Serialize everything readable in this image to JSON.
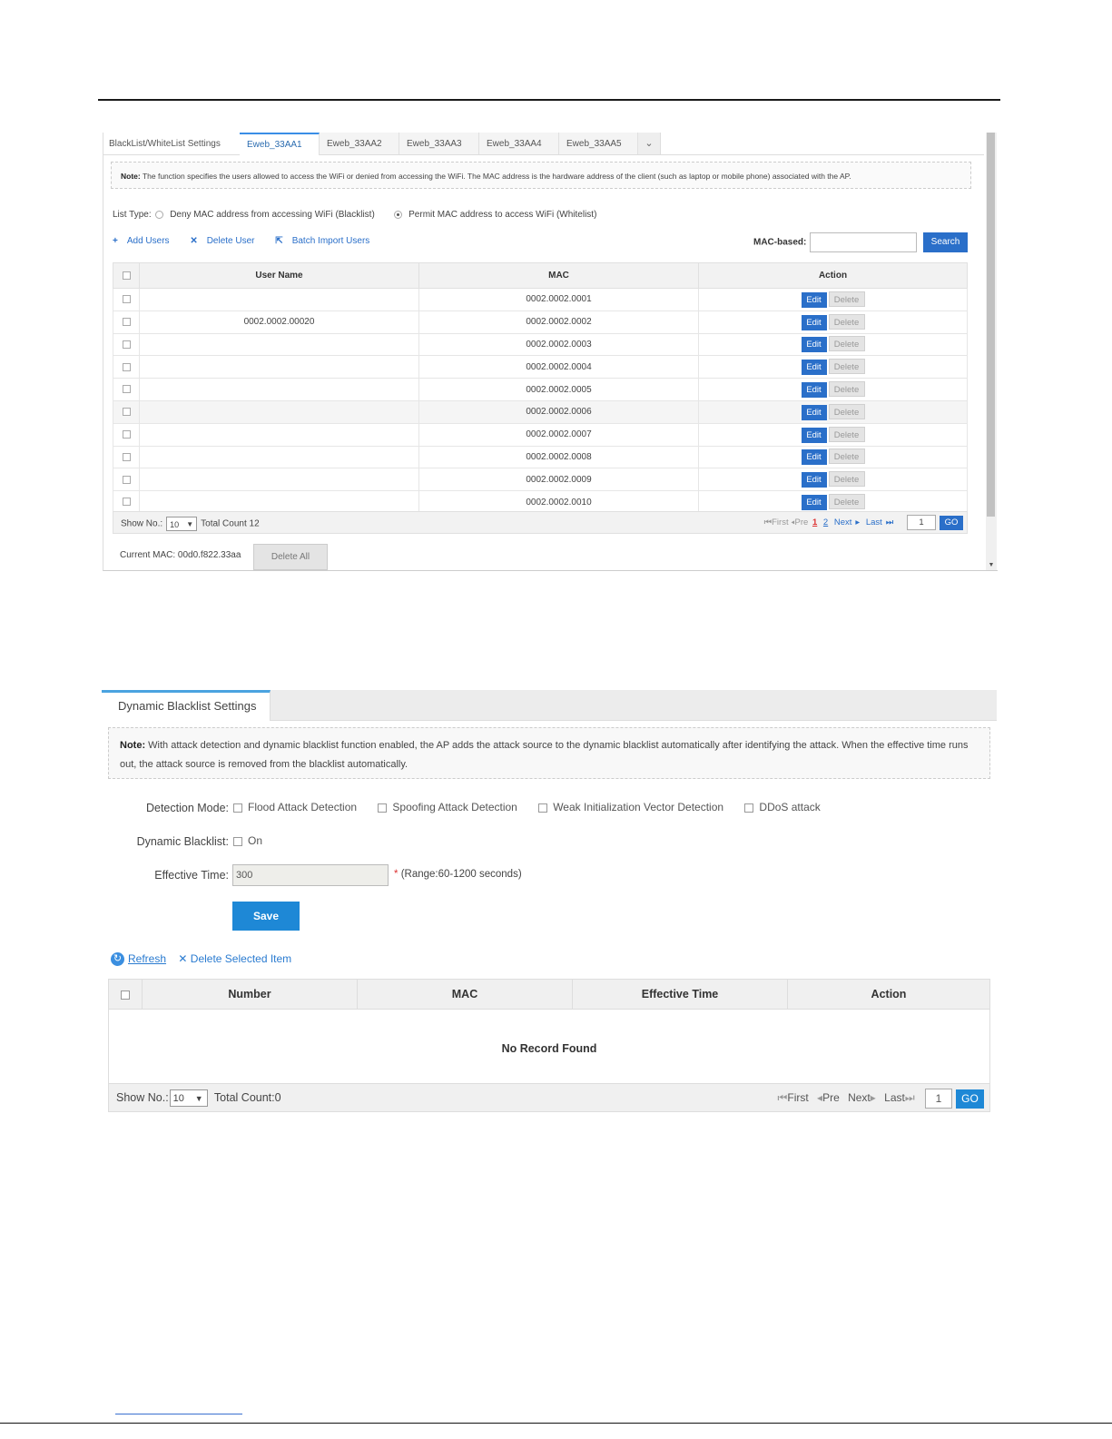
{
  "shot1": {
    "tabs": [
      "BlackList/WhiteList Settings",
      "Eweb_33AA1",
      "Eweb_33AA2",
      "Eweb_33AA3",
      "Eweb_33AA4",
      "Eweb_33AA5"
    ],
    "note_label": "Note:",
    "note_text": "The function specifies the users allowed to access the WiFi or denied from accessing the WiFi. The MAC address is the hardware address of the client (such as laptop or mobile phone) associated with the AP.",
    "list_type_label": "List Type:",
    "radio_blacklist": "Deny MAC address from accessing WiFi (Blacklist)",
    "radio_whitelist": "Permit MAC address to access WiFi (Whitelist)",
    "add_users": "Add Users",
    "delete_user": "Delete User",
    "batch_import": "Batch Import Users",
    "mac_based_label": "MAC-based:",
    "search_button": "Search",
    "columns": [
      "User Name",
      "MAC",
      "Action"
    ],
    "rows": [
      {
        "user": "",
        "mac": "0002.0002.0001"
      },
      {
        "user": "0002.0002.00020",
        "mac": "0002.0002.0002"
      },
      {
        "user": "",
        "mac": "0002.0002.0003"
      },
      {
        "user": "",
        "mac": "0002.0002.0004"
      },
      {
        "user": "",
        "mac": "0002.0002.0005"
      },
      {
        "user": "",
        "mac": "0002.0002.0006"
      },
      {
        "user": "",
        "mac": "0002.0002.0007"
      },
      {
        "user": "",
        "mac": "0002.0002.0008"
      },
      {
        "user": "",
        "mac": "0002.0002.0009"
      },
      {
        "user": "",
        "mac": "0002.0002.0010"
      }
    ],
    "edit_label": "Edit",
    "delete_label": "Delete",
    "show_no_label": "Show No.:",
    "show_no_value": "10",
    "total_count": "Total Count 12",
    "pager": {
      "first": "First",
      "pre": "Pre",
      "page1": "1",
      "page2": "2",
      "next": "Next",
      "last": "Last",
      "page_input": "1",
      "go": "GO"
    },
    "current_mac": "Current MAC: 00d0.f822.33aa",
    "delete_all": "Delete All"
  },
  "shot2": {
    "tab": "Dynamic Blacklist Settings",
    "note_label": "Note:",
    "note_text": "With attack detection and dynamic blacklist function enabled, the AP adds the attack source to the dynamic blacklist automatically after identifying the attack. When the effective time runs out, the attack source is removed from the blacklist automatically.",
    "detection_mode_label": "Detection Mode:",
    "detection_options": [
      "Flood Attack Detection",
      "Spoofing Attack Detection",
      "Weak Initialization Vector Detection",
      "DDoS attack"
    ],
    "dynamic_blacklist_label": "Dynamic Blacklist:",
    "dynamic_blacklist_option": "On",
    "effective_time_label": "Effective Time:",
    "effective_time_value": "300",
    "range_star": "*",
    "range_text": "(Range:60-1200 seconds)",
    "save": "Save",
    "refresh": "Refresh",
    "delete_selected": "Delete Selected Item",
    "columns": [
      "Number",
      "MAC",
      "Effective Time",
      "Action"
    ],
    "empty_text": "No Record Found",
    "show_no_label": "Show No.:",
    "show_no_value": "10",
    "total_count": "Total Count:0",
    "pager": {
      "first": "First",
      "pre": "Pre",
      "next": "Next",
      "last": "Last",
      "page_input": "1",
      "go": "GO"
    }
  },
  "colors": {
    "accent_blue": "#2a6fc9",
    "save_blue": "#1e88d6",
    "page_red": "#dd3333"
  }
}
